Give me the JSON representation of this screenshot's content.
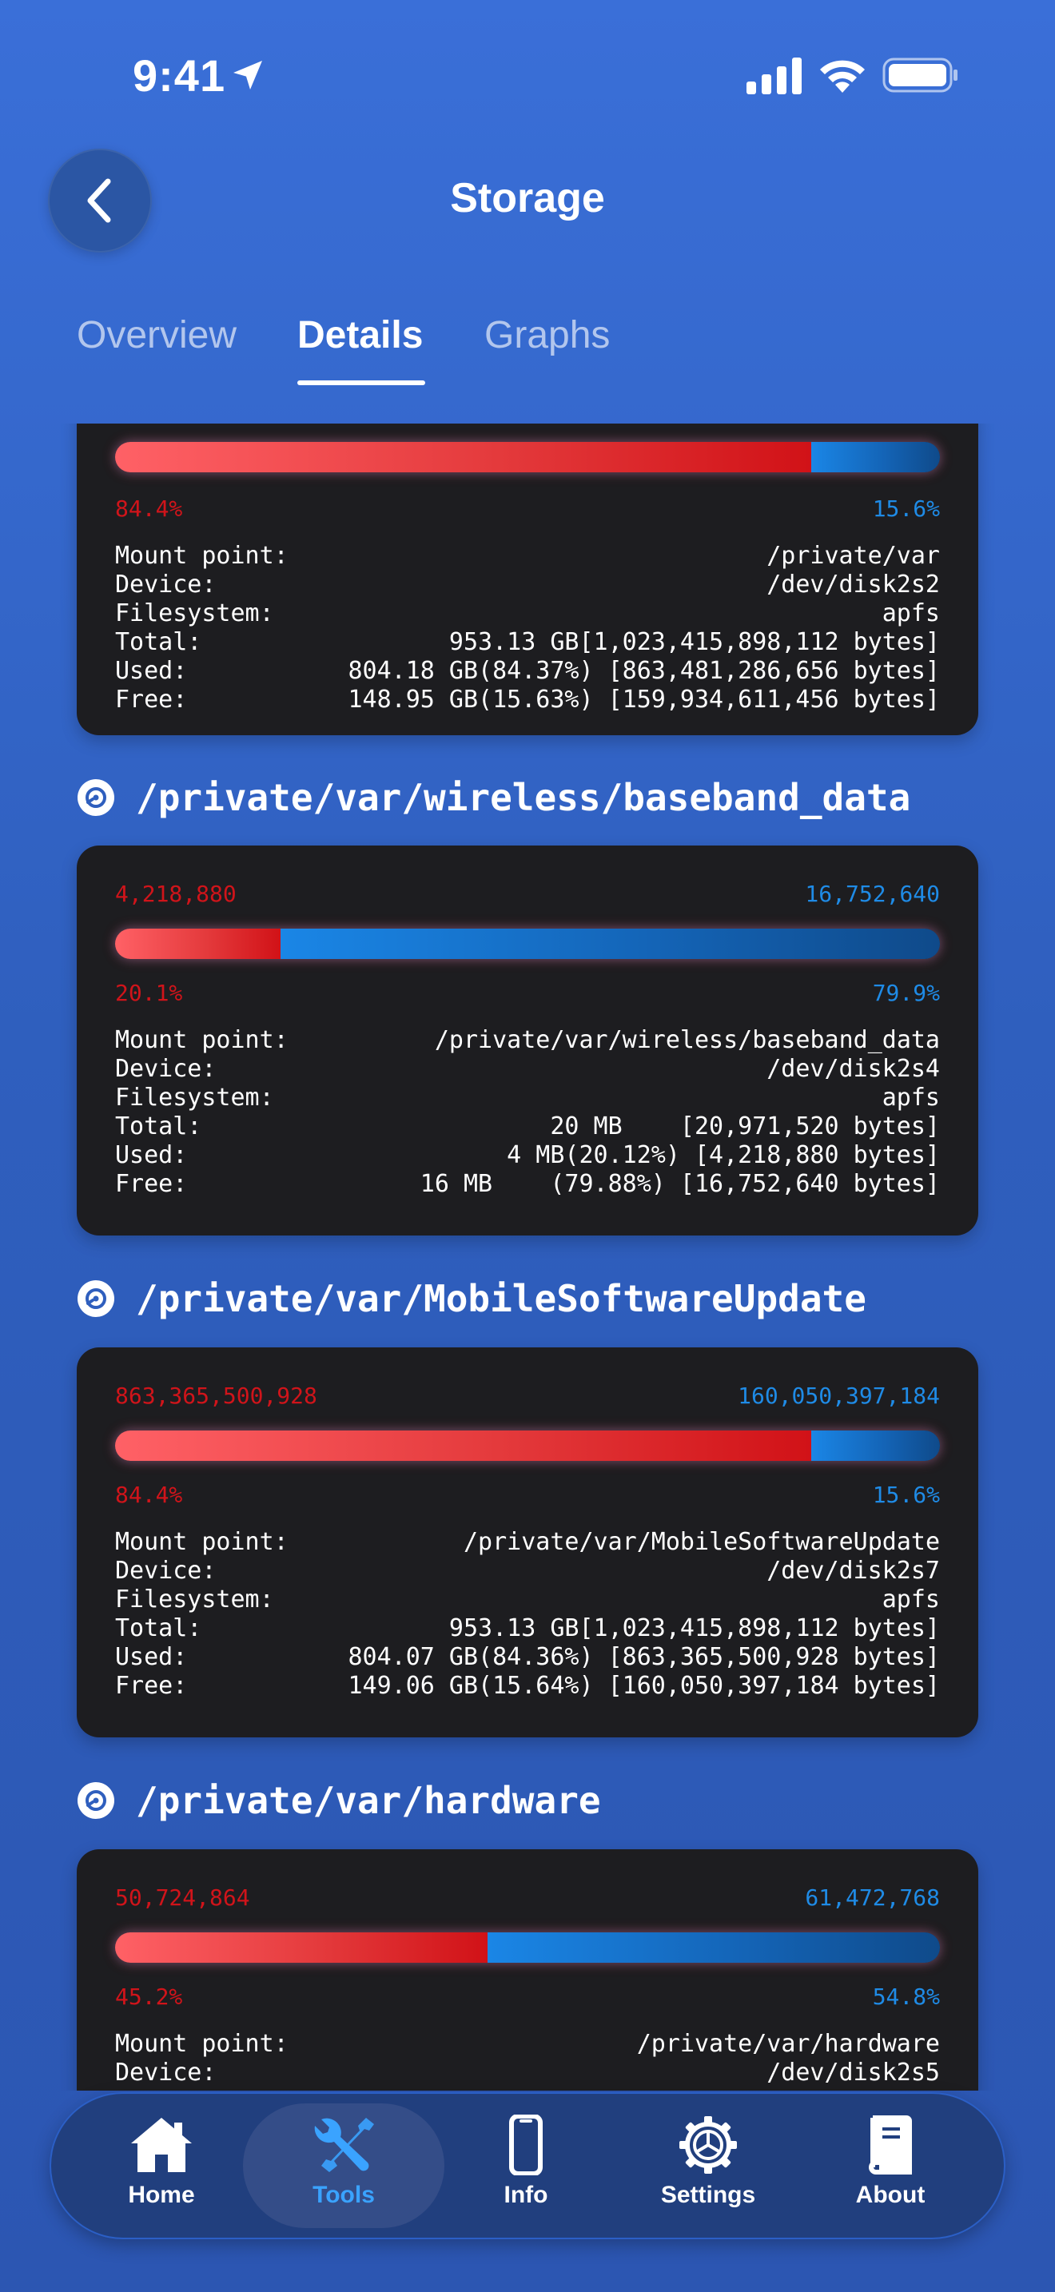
{
  "status_bar": {
    "time": "9:41"
  },
  "header": {
    "title": "Storage",
    "back_icon": "chevron-left-icon"
  },
  "tabs": [
    {
      "label": "Overview",
      "active": false
    },
    {
      "label": "Details",
      "active": true
    },
    {
      "label": "Graphs",
      "active": false
    }
  ],
  "colors": {
    "background": "#3366cc",
    "card": "#1d1d20",
    "used": "#d0141a",
    "free": "#1f8be6",
    "tab_active": "#3aa3ff"
  },
  "volumes": [
    {
      "title": "",
      "used_bytes_label": "",
      "free_bytes_label": "",
      "used_fraction": 0.844,
      "used_pct": "84.4%",
      "free_pct": "15.6%",
      "rows": [
        {
          "key": "Mount point:",
          "value": "/private/var"
        },
        {
          "key": "Device:",
          "value": "/dev/disk2s2"
        },
        {
          "key": "Filesystem:",
          "value": "apfs"
        },
        {
          "key": "Total:",
          "value": "953.13 GB[1,023,415,898,112 bytes]"
        },
        {
          "key": "Used:",
          "value": "804.18 GB(84.37%) [863,481,286,656 bytes]"
        },
        {
          "key": "Free:",
          "value": "148.95 GB(15.63%) [159,934,611,456 bytes]"
        }
      ]
    },
    {
      "title": "/private/var/wireless/baseband_data",
      "used_bytes_label": "4,218,880",
      "free_bytes_label": "16,752,640",
      "used_fraction": 0.201,
      "used_pct": "20.1%",
      "free_pct": "79.9%",
      "rows": [
        {
          "key": "Mount point:",
          "value": "/private/var/wireless/baseband_data"
        },
        {
          "key": "Device:",
          "value": "/dev/disk2s4"
        },
        {
          "key": "Filesystem:",
          "value": "apfs"
        },
        {
          "key": "Total:",
          "value": "20 MB    [20,971,520 bytes]"
        },
        {
          "key": "Used:",
          "value": "4 MB(20.12%) [4,218,880 bytes]"
        },
        {
          "key": "Free:",
          "value": "16 MB    (79.88%) [16,752,640 bytes]"
        }
      ]
    },
    {
      "title": "/private/var/MobileSoftwareUpdate",
      "used_bytes_label": "863,365,500,928",
      "free_bytes_label": "160,050,397,184",
      "used_fraction": 0.844,
      "used_pct": "84.4%",
      "free_pct": "15.6%",
      "rows": [
        {
          "key": "Mount point:",
          "value": "/private/var/MobileSoftwareUpdate"
        },
        {
          "key": "Device:",
          "value": "/dev/disk2s7"
        },
        {
          "key": "Filesystem:",
          "value": "apfs"
        },
        {
          "key": "Total:",
          "value": "953.13 GB[1,023,415,898,112 bytes]"
        },
        {
          "key": "Used:",
          "value": "804.07 GB(84.36%) [863,365,500,928 bytes]"
        },
        {
          "key": "Free:",
          "value": "149.06 GB(15.64%) [160,050,397,184 bytes]"
        }
      ]
    },
    {
      "title": "/private/var/hardware",
      "used_bytes_label": "50,724,864",
      "free_bytes_label": "61,472,768",
      "used_fraction": 0.452,
      "used_pct": "45.2%",
      "free_pct": "54.8%",
      "rows": [
        {
          "key": "Mount point:",
          "value": "/private/var/hardware"
        },
        {
          "key": "Device:",
          "value": "/dev/disk2s5"
        }
      ]
    }
  ],
  "tabbar": [
    {
      "label": "Home",
      "icon": "house-icon",
      "active": false
    },
    {
      "label": "Tools",
      "icon": "tools-icon",
      "active": true
    },
    {
      "label": "Info",
      "icon": "phone-icon",
      "active": false
    },
    {
      "label": "Settings",
      "icon": "gear-icon",
      "active": false
    },
    {
      "label": "About",
      "icon": "book-icon",
      "active": false
    }
  ]
}
